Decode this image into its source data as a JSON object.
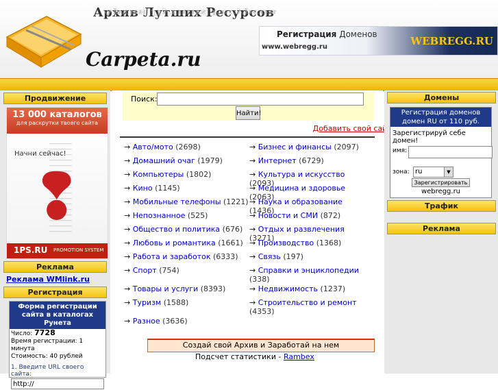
{
  "header": {
    "title": "Архив Лутших Ресурсов",
    "site_name": "Carpeta.ru",
    "banner": {
      "title_bold": "Регистрация",
      "title_rest": " Доменов",
      "url": "www.webregg.ru",
      "brand": "WEBREGG.RU"
    }
  },
  "left": {
    "promo_title": "Продвижение",
    "promo": {
      "count": "13 000 каталогов",
      "sub": "для раскрутки твоего сайта",
      "start": "Начни сейчас!",
      "brand": "1PS.RU",
      "system": "PROMOTION SYSTEM"
    },
    "ads_title": "Реклама",
    "wmlink": "Реклама WMlink.ru",
    "reg_title": "Регистрация",
    "reg_form": {
      "head": "Форма регистрации сайта в каталогах Рунета",
      "count_label": "Число: ",
      "count_value": "7728",
      "time": "Время регистрации: 1 минута",
      "cost": "Стоимость: 40 рублей",
      "step": "1. Введите URL своего сайта:",
      "url_value": "http://"
    }
  },
  "main": {
    "search_label": "Поиск:",
    "search_value": "",
    "search_button": "Найти!",
    "add_site": "Добавить свой сайт Архив Лутших Ресурсов",
    "categories_left": [
      {
        "name": "Авто/мото",
        "count": "(2698)"
      },
      {
        "name": "Домашний очаг",
        "count": "(1979)"
      },
      {
        "name": "Компьютеры",
        "count": "(1802)"
      },
      {
        "name": "Кино",
        "count": "(1145)"
      },
      {
        "name": "Мобильные телефоны",
        "count": "(1221)"
      },
      {
        "name": "Непознанное",
        "count": "(525)"
      },
      {
        "name": "Общество и политика",
        "count": "(676)"
      },
      {
        "name": "Любовь и романтика",
        "count": "(1661)"
      },
      {
        "name": "Работа и заработок",
        "count": "(6333)"
      },
      {
        "name": "Спорт",
        "count": "(754)"
      },
      {
        "name": "Товары и услуги",
        "count": "(8393)"
      },
      {
        "name": "Туризм",
        "count": "(1588)"
      },
      {
        "name": "Разное",
        "count": "(3636)"
      }
    ],
    "categories_right": [
      {
        "name": "Бизнес и финансы",
        "count": "(2097)"
      },
      {
        "name": "Интернет",
        "count": "(6729)"
      },
      {
        "name": "Культура и искусство",
        "count": "(2093)"
      },
      {
        "name": "Медицина и здоровье",
        "count": "(2063)"
      },
      {
        "name": "Наука и образование",
        "count": "(1436)"
      },
      {
        "name": "Новости и СМИ",
        "count": "(872)"
      },
      {
        "name": "Отдых и развлечения",
        "count": "(3271)"
      },
      {
        "name": "Производство",
        "count": "(1368)"
      },
      {
        "name": "Связь",
        "count": "(197)"
      },
      {
        "name": "Справки и энциклопедии",
        "count": "(338)"
      },
      {
        "name": "Недвижимость",
        "count": "(1237)"
      },
      {
        "name": "Строительство и ремонт",
        "count": "(4353)"
      }
    ],
    "create_archive": "Создай свой Архив и Заработай на нем",
    "stats_text": "Подсчет статистики - ",
    "stats_link": "Rambex"
  },
  "right": {
    "domains_title": "Домены",
    "domain_box": {
      "head": "Регистрация доменов домен RU от 110 руб.",
      "invite": "Зарегистрируй себе домен!",
      "name_label": "имя:",
      "zone_label": "зона:",
      "zone_value": "ru",
      "submit": "Зарегистрировать",
      "footer": "webregg.ru"
    },
    "traffic_title": "Трафик",
    "ads_title": "Реклама"
  },
  "colors": {
    "accent_yellow": "#f4c20d",
    "link_blue": "#0000cc",
    "add_site_red": "#cc0000",
    "form_blue": "#1f3a88"
  }
}
